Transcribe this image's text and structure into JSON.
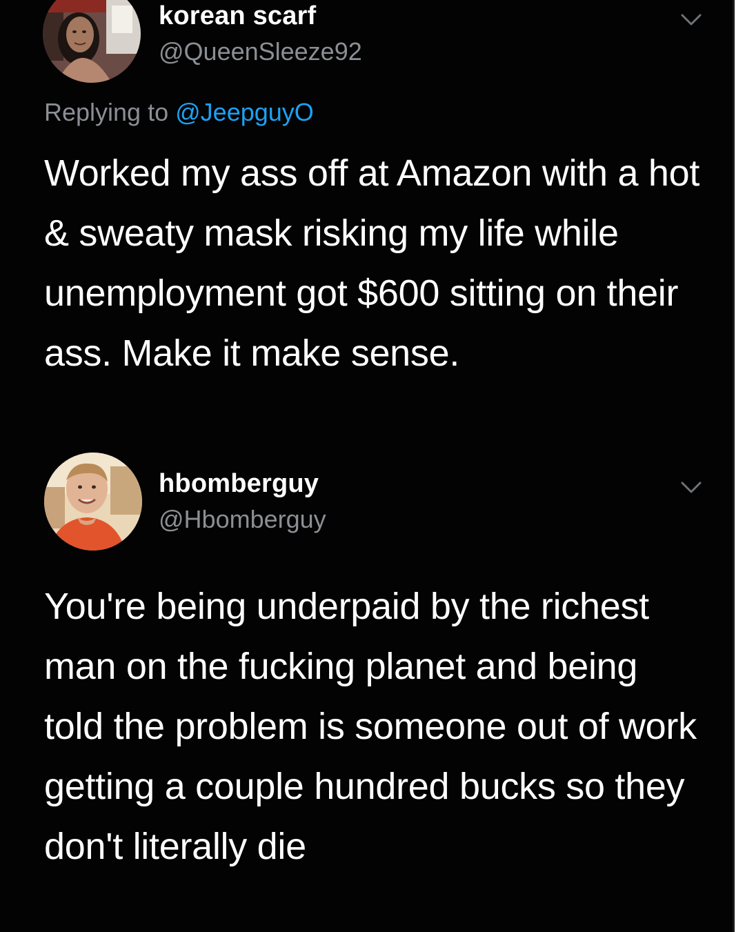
{
  "tweets": [
    {
      "display_name": "korean scarf",
      "handle": "@QueenSleeze92",
      "reply_prefix": "Replying to",
      "reply_mention": "@JeepguyO",
      "text": "Worked my ass off at Amazon with a hot & sweaty mask risking my life while unemployment got $600 sitting on their ass. Make it make sense.",
      "menu_icon": "chevron-down-icon"
    },
    {
      "display_name": "hbomberguy",
      "handle": "@Hbomberguy",
      "text": "You're being underpaid by the richest man on the fucking planet and being told the problem is someone out of work getting a couple hundred bucks so they don't literally die",
      "menu_icon": "chevron-down-icon"
    }
  ],
  "colors": {
    "background": "#030303",
    "text": "#ffffff",
    "secondary_text": "#8b8f94",
    "mention": "#1da1f2"
  }
}
